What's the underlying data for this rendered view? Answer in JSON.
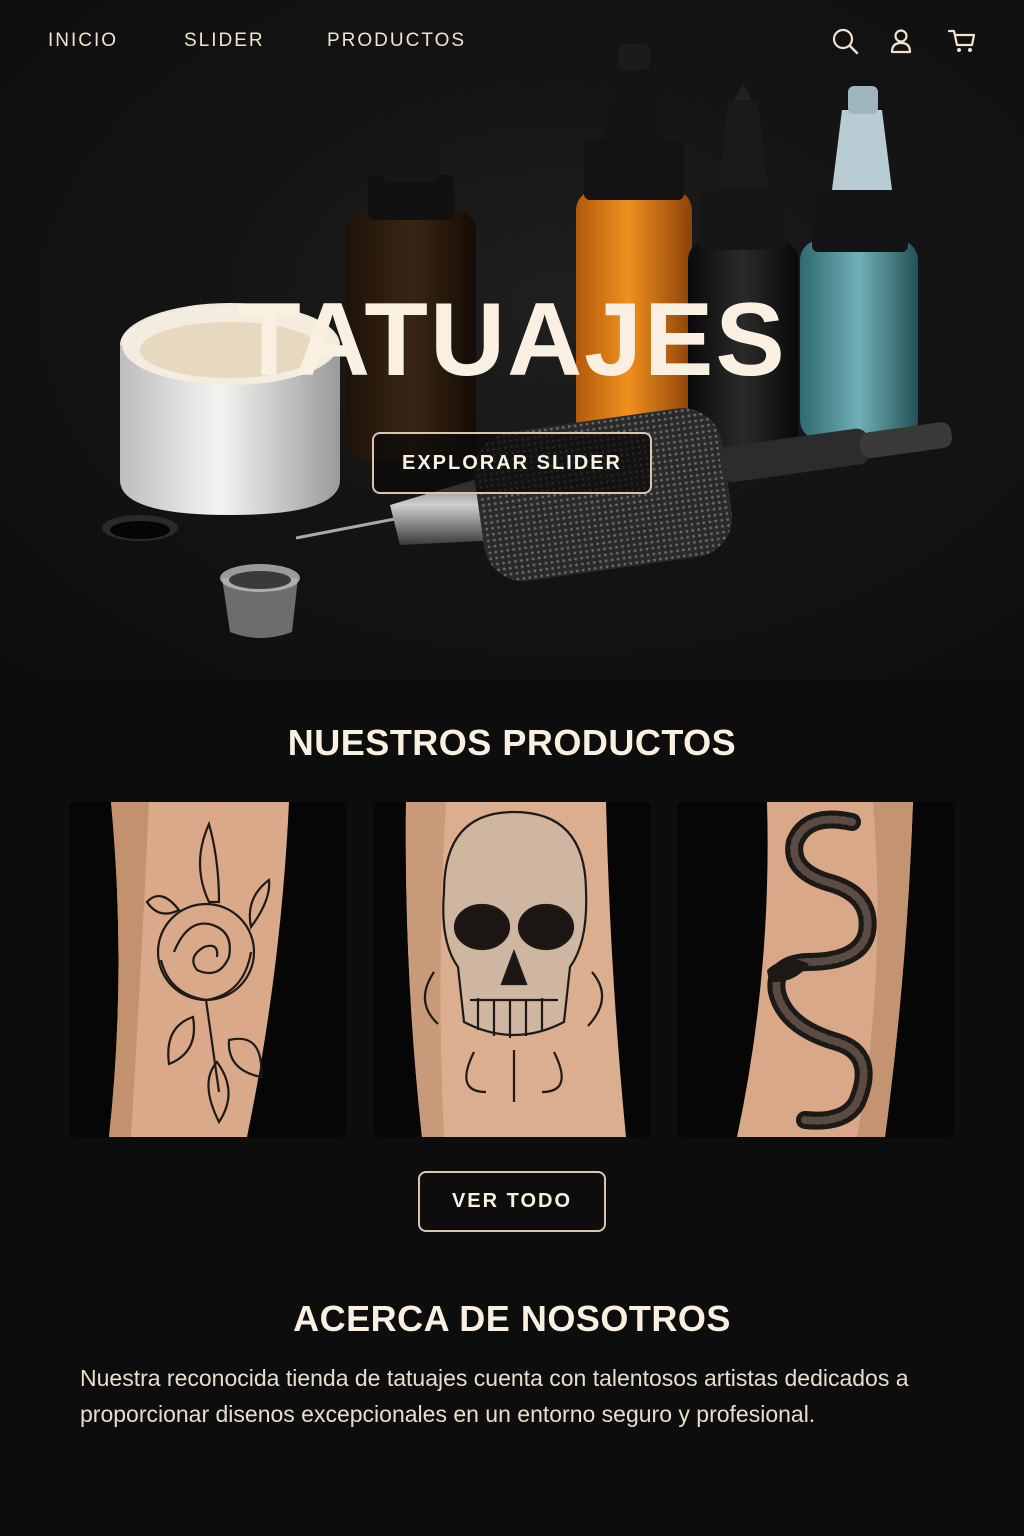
{
  "nav": {
    "links": [
      "INICIO",
      "SLIDER",
      "PRODUCTOS"
    ],
    "icons": [
      "search-icon",
      "user-icon",
      "cart-icon"
    ]
  },
  "hero": {
    "title": "TATUAJES",
    "button_label": "EXPLORAR SLIDER"
  },
  "products": {
    "title": "NUESTROS PRODUCTOS",
    "items": [
      {
        "image": "rose-tattoo"
      },
      {
        "image": "skull-tattoo"
      },
      {
        "image": "snake-tattoo"
      }
    ],
    "view_all_label": "VER TODO"
  },
  "about": {
    "title": "ACERCA DE NOSOTROS",
    "text": "Nuestra reconocida tienda de tatuajes cuenta con talentosos artistas dedicados a proporcionar disenos excepcionales en un entorno seguro y profesional."
  },
  "colors": {
    "background": "#0d0d0d",
    "accent": "#d9c6ad",
    "text": "#faf0e2"
  }
}
